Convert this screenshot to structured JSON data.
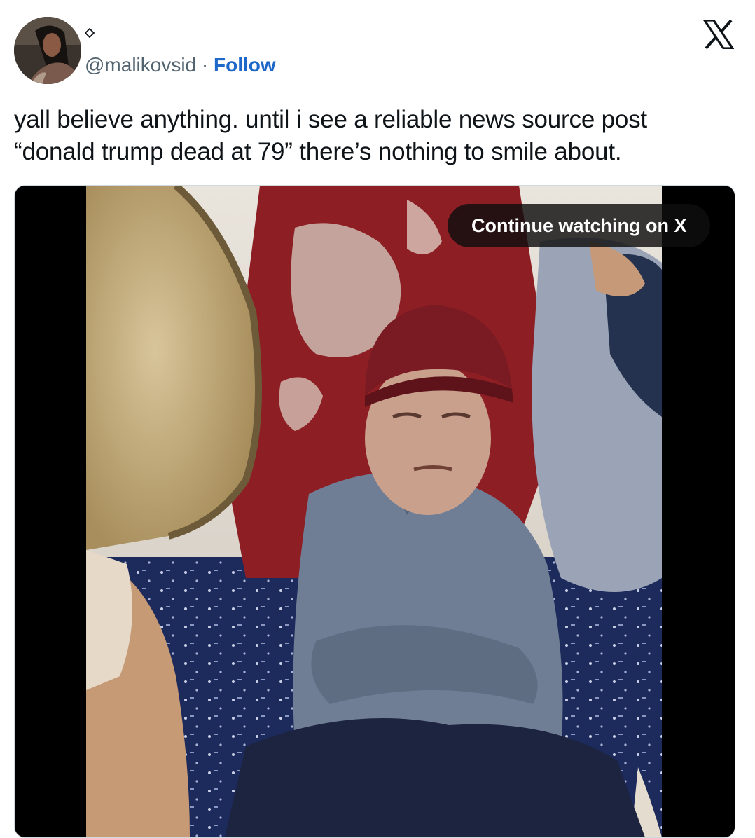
{
  "tweet": {
    "author_handle": "@malikovsid",
    "separator": "·",
    "follow_label": "Follow",
    "text_line1": "yall believe anything. until i see a reliable news source post",
    "text_line2": "“donald trump dead at 79” there’s nothing to smile about."
  },
  "media": {
    "cta_label": "Continue watching on X"
  },
  "colors": {
    "follow_link": "#1d68c9",
    "muted_text": "#536471",
    "border": "#cfd9de"
  },
  "icons": {
    "badge": "diamond-outline-icon",
    "brand": "x-logo-icon"
  }
}
